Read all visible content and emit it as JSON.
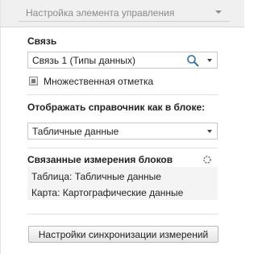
{
  "header": {
    "title": "Настройка элемента управления",
    "icon": "chevron-down-icon"
  },
  "link_section": {
    "title": "Связь",
    "combo_value": "Связь 1 (Типы данных)",
    "search_icon": "search-icon",
    "dropdown_icon": "chevron-down-icon"
  },
  "multi_select": {
    "label": "Множественная отметка",
    "checked": false
  },
  "display_section": {
    "title": "Отображать справочник как в блоке:",
    "combo_value": "Табличные данные",
    "dropdown_icon": "chevron-down-icon"
  },
  "linked_dims": {
    "title": "Связанные измерения блоков",
    "refresh_icon": "refresh-icon",
    "items": [
      {
        "text": "Таблица: Табличные данные"
      },
      {
        "text": "Карта: Картографические данные"
      }
    ]
  },
  "sync_button": {
    "label": "Настройки синхронизации измерений"
  },
  "colors": {
    "accent": "#2f6fb3",
    "header_bg": "#f0f0f0",
    "list_bg": "#f4f4f4"
  }
}
